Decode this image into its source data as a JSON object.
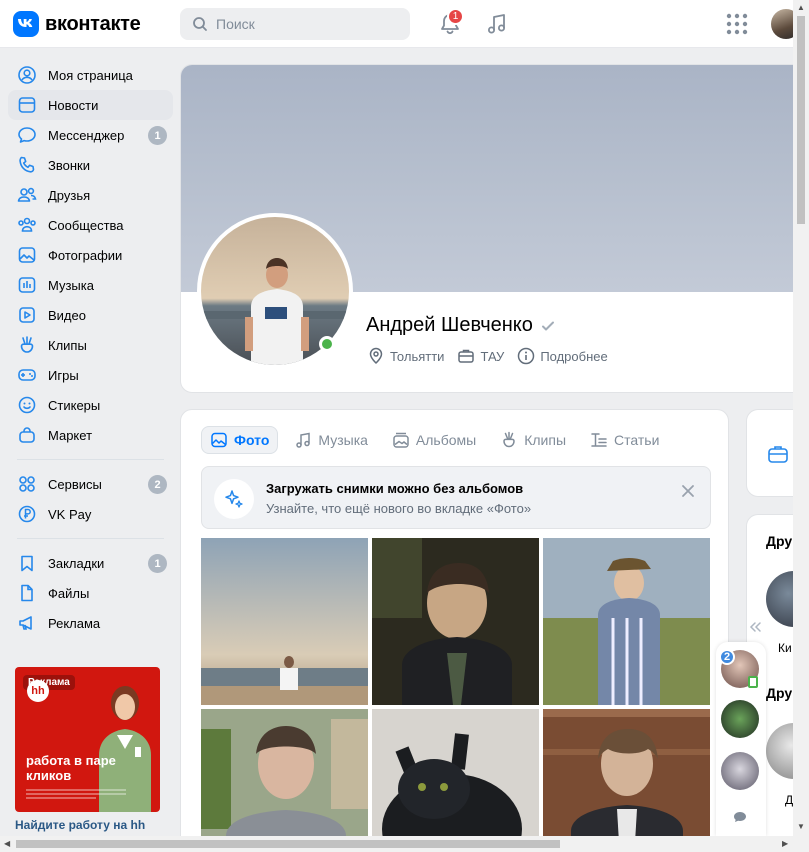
{
  "header": {
    "logo_text": "вконтакте",
    "search_placeholder": "Поиск",
    "notification_count": "1"
  },
  "sidebar": {
    "items": [
      {
        "label": "Моя страница",
        "icon": "user-circle-icon"
      },
      {
        "label": "Новости",
        "icon": "newsfeed-icon"
      },
      {
        "label": "Мессенджер",
        "icon": "message-icon",
        "count": "1"
      },
      {
        "label": "Звонки",
        "icon": "phone-icon"
      },
      {
        "label": "Друзья",
        "icon": "users-icon"
      },
      {
        "label": "Сообщества",
        "icon": "communities-icon"
      },
      {
        "label": "Фотографии",
        "icon": "picture-icon"
      },
      {
        "label": "Музыка",
        "icon": "music-icon"
      },
      {
        "label": "Видео",
        "icon": "video-icon"
      },
      {
        "label": "Клипы",
        "icon": "clips-icon"
      },
      {
        "label": "Игры",
        "icon": "gamepad-icon"
      },
      {
        "label": "Стикеры",
        "icon": "smile-icon"
      },
      {
        "label": "Маркет",
        "icon": "market-bag-icon"
      },
      {
        "label": "Сервисы",
        "icon": "services-grid-icon",
        "count": "2"
      },
      {
        "label": "VK Pay",
        "icon": "vkpay-icon"
      },
      {
        "label": "Закладки",
        "icon": "bookmark-icon",
        "count": "1"
      },
      {
        "label": "Файлы",
        "icon": "file-icon"
      },
      {
        "label": "Реклама",
        "icon": "megaphone-icon"
      }
    ],
    "ad": {
      "badge": "Реклама",
      "logo": "hh",
      "headline": "работа в паре кликов",
      "caption": "Найдите работу на hh"
    }
  },
  "profile": {
    "name": "Андрей Шевченко",
    "city": "Тольятти",
    "university": "ТАУ",
    "more": "Подробнее"
  },
  "photos_block": {
    "tabs": [
      "Фото",
      "Музыка",
      "Альбомы",
      "Клипы",
      "Статьи"
    ],
    "active_tab": "Фото",
    "tip_title": "Загружать снимки можно без альбомов",
    "tip_subtitle": "Узнайте, что ещё нового во вкладке «Фото»"
  },
  "right_column": {
    "friends_title": "Дру",
    "friend_name": "Ки",
    "friends_online_title": "Дру",
    "friend_online_name": "Д"
  },
  "chat_rail": {
    "unread": "2"
  },
  "colors": {
    "accent": "#0077ff",
    "online": "#4bb34b",
    "badge_red": "#e64646",
    "background": "#edeef0"
  }
}
